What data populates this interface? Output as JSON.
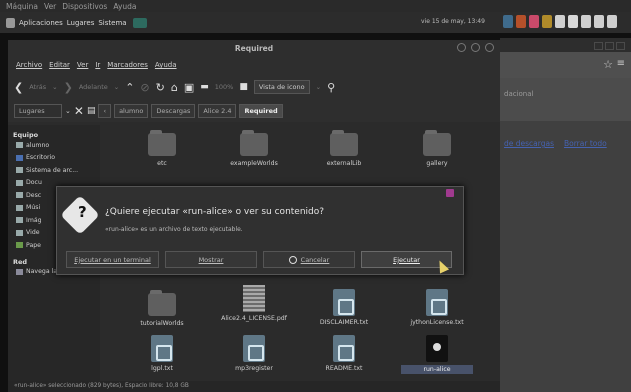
{
  "vm_menu": [
    "Máquina",
    "Ver",
    "Dispositivos",
    "Ayuda"
  ],
  "top_panel": {
    "items": [
      "Aplicaciones",
      "Lugares",
      "Sistema"
    ],
    "datetime": "vie 15 de may, 13:49"
  },
  "window": {
    "title": "Required",
    "menu": [
      "Archivo",
      "Editar",
      "Ver",
      "Ir",
      "Marcadores",
      "Ayuda"
    ],
    "toolbar": {
      "back": "Atrás",
      "forward": "Adelante",
      "zoom": "100%",
      "view_mode": "Vista de icono"
    },
    "sidebar_select": "Lugares",
    "breadcrumbs": [
      "alumno",
      "Descargas",
      "Alice 2.4",
      "Required"
    ],
    "sidebar": {
      "equipo_heading": "Equipo",
      "equipo": [
        "alumno",
        "Escritorio",
        "Sistema de arc...",
        "Docu",
        "Desc",
        "Músi",
        "Imág",
        "Vide",
        "Pape"
      ],
      "red_heading": "Red",
      "red": [
        "Navega la red"
      ]
    },
    "files": [
      {
        "name": "etc",
        "kind": "folder"
      },
      {
        "name": "exampleWorlds",
        "kind": "folder"
      },
      {
        "name": "externalLib",
        "kind": "folder"
      },
      {
        "name": "gallery",
        "kind": "folder"
      },
      {
        "name": "tutorialWorlds",
        "kind": "folder"
      },
      {
        "name": "Alice2.4_LICENSE.pdf",
        "kind": "pdf"
      },
      {
        "name": "DISCLAIMER.txt",
        "kind": "text"
      },
      {
        "name": "jythonLicense.txt",
        "kind": "text"
      },
      {
        "name": "lgpl.txt",
        "kind": "text"
      },
      {
        "name": "mp3register",
        "kind": "text"
      },
      {
        "name": "README.txt",
        "kind": "text"
      },
      {
        "name": "run-alice",
        "kind": "executable",
        "selected": true
      }
    ],
    "status": "«run-alice» seleccionado (829 bytes), Espacio libre: 10,8 GB"
  },
  "dialog": {
    "title": "¿Quiere ejecutar «run-alice» o ver su contenido?",
    "message": "«run-alice» es un archivo de texto ejecutable.",
    "buttons": {
      "terminal": "Ejecutar en un terminal",
      "show": "Mostrar",
      "cancel": "Cancelar",
      "run": "Ejecutar"
    }
  },
  "browser": {
    "partial_text": "dacional",
    "link_downloads": "de descargas",
    "link_clear": "Borrar todo"
  }
}
